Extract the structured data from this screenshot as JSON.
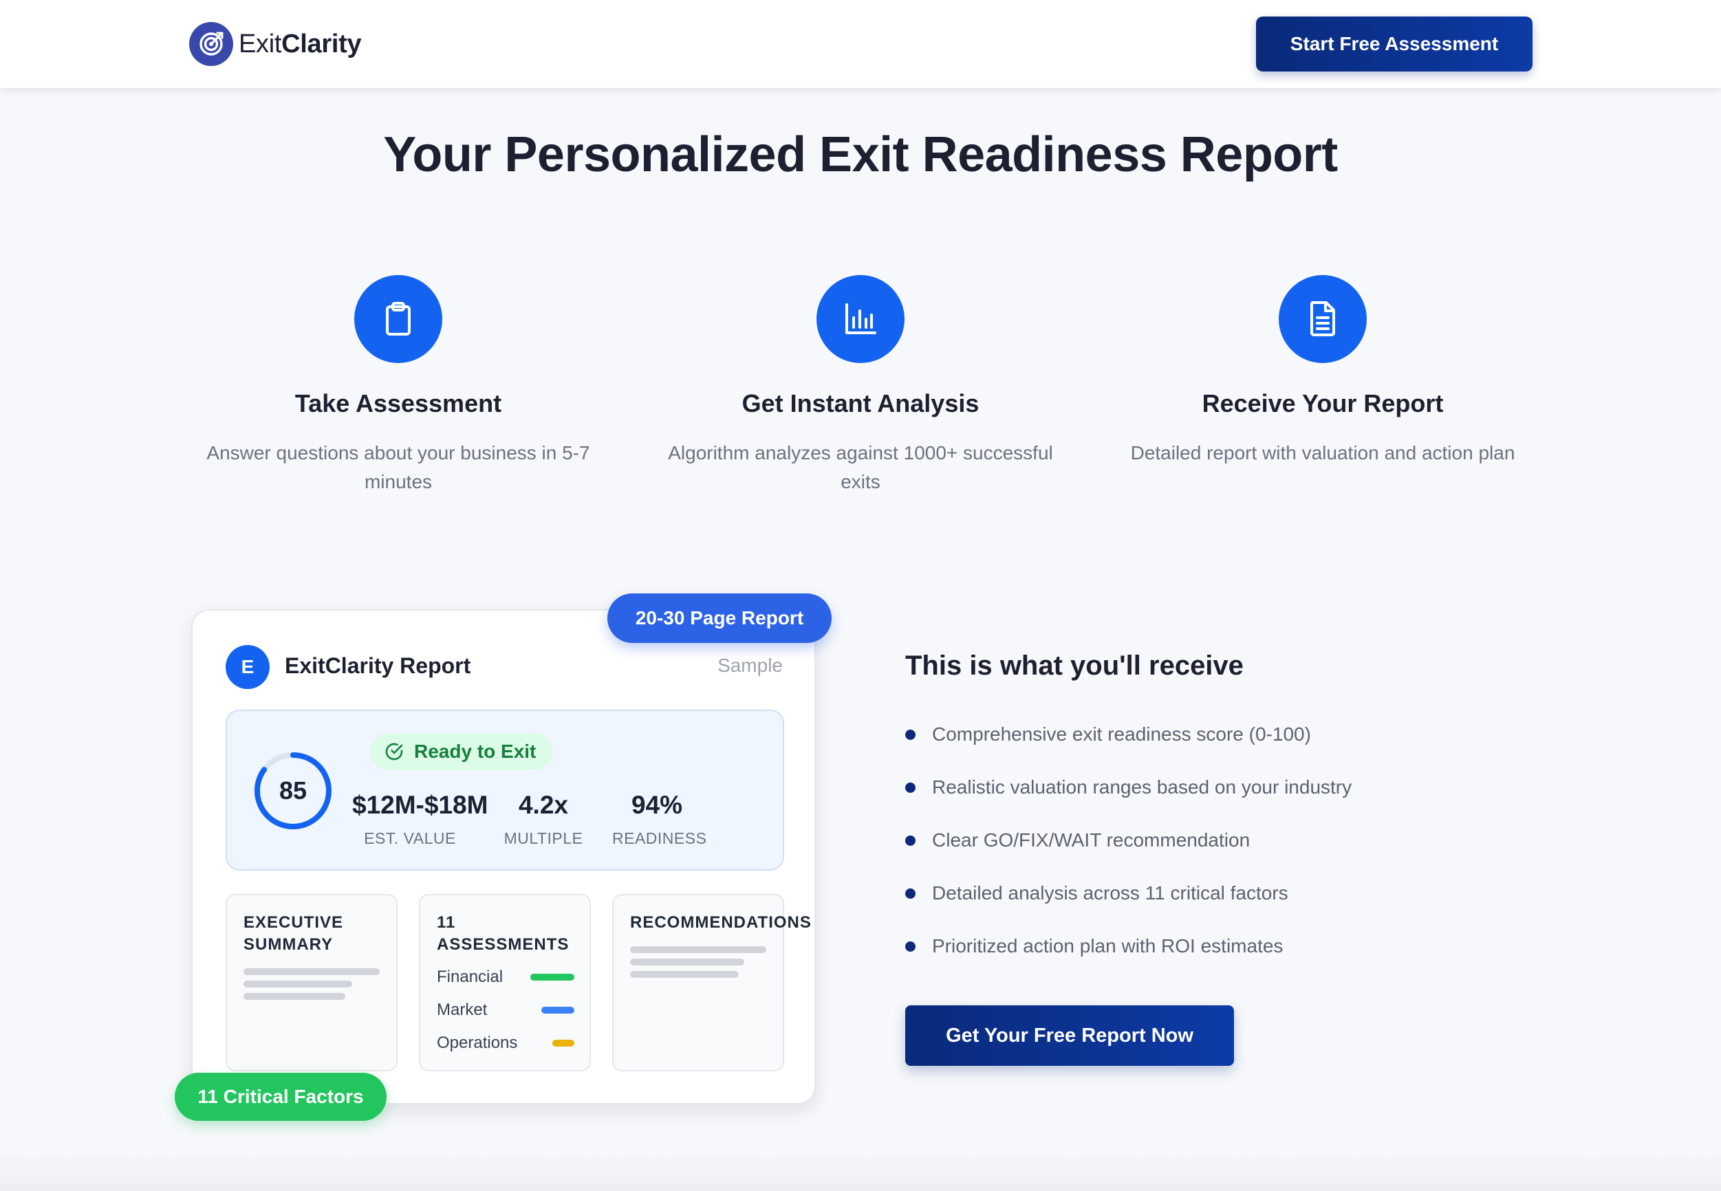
{
  "header": {
    "logo_text_light": "Exit",
    "logo_text_bold": "Clarity",
    "logo_icon": "target-icon",
    "cta_label": "Start Free Assessment"
  },
  "hero": {
    "title": "Your Personalized Exit Readiness Report"
  },
  "steps": [
    {
      "icon": "clipboard-icon",
      "title": "Take Assessment",
      "description": "Answer questions about your business in 5-7 minutes"
    },
    {
      "icon": "bar-chart-icon",
      "title": "Get Instant Analysis",
      "description": "Algorithm analyzes against 1000+ successful exits"
    },
    {
      "icon": "document-icon",
      "title": "Receive Your Report",
      "description": "Detailed report with valuation and action plan"
    }
  ],
  "report_preview": {
    "badge_pages": "20-30 Page Report",
    "badge_factors": "11 Critical Factors",
    "avatar_letter": "E",
    "title": "ExitClarity Report",
    "sample_label": "Sample",
    "score": "85",
    "score_fraction": 0.85,
    "status": "Ready to Exit",
    "metrics": [
      {
        "value": "$12M-$18M",
        "label": "EST. VALUE"
      },
      {
        "value": "4.2x",
        "label": "MULTIPLE"
      },
      {
        "value": "94%",
        "label": "READINESS"
      }
    ],
    "sections": {
      "executive_summary": "EXECUTIVE SUMMARY",
      "assessments_count": "11",
      "assessments": "ASSESSMENTS",
      "recommendations": "RECOMMENDATIONS"
    },
    "factors": [
      {
        "name": "Financial",
        "color": "#22c55e"
      },
      {
        "name": "Market",
        "color": "#3b82f6"
      },
      {
        "name": "Operations",
        "color": "#eab308"
      }
    ]
  },
  "benefits": {
    "title": "This is what you'll receive",
    "items": [
      "Comprehensive exit readiness score (0-100)",
      "Realistic valuation ranges based on your industry",
      "Clear GO/FIX/WAIT recommendation",
      "Detailed analysis across 11 critical factors",
      "Prioritized action plan with ROI estimates"
    ],
    "cta_label": "Get Your Free Report Now"
  },
  "colors": {
    "primary_blue": "#1463f0",
    "navy": "#0d2a7a",
    "success_green": "#22c55e",
    "background": "#f7f8fb"
  }
}
